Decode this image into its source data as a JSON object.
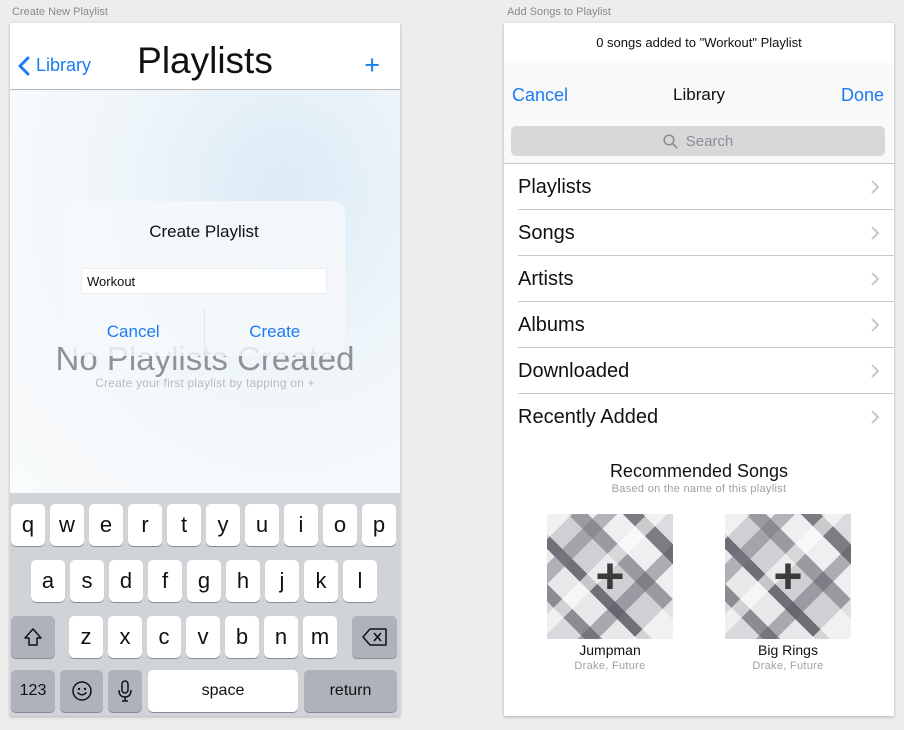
{
  "artboards": {
    "left_label": "Create New Playlist",
    "right_label": "Add Songs to Playlist"
  },
  "left_screen": {
    "nav": {
      "back_label": "Library",
      "title": "Playlists",
      "add_symbol": "+"
    },
    "empty_state": {
      "title": "No Playlists Created",
      "subtitle": "Create your first playlist by tapping on +"
    },
    "dialog": {
      "title": "Create Playlist",
      "input_value": "Workout",
      "cancel_label": "Cancel",
      "create_label": "Create"
    },
    "keyboard": {
      "row1": [
        "q",
        "w",
        "e",
        "r",
        "t",
        "y",
        "u",
        "i",
        "o",
        "p"
      ],
      "row2": [
        "a",
        "s",
        "d",
        "f",
        "g",
        "h",
        "j",
        "k",
        "l"
      ],
      "row3": [
        "z",
        "x",
        "c",
        "v",
        "b",
        "n",
        "m"
      ],
      "numbers_label": "123",
      "space_label": "space",
      "return_label": "return"
    }
  },
  "right_screen": {
    "banner": "0 songs added to \"Workout\" Playlist",
    "nav": {
      "cancel_label": "Cancel",
      "title": "Library",
      "done_label": "Done"
    },
    "search": {
      "placeholder": "Search"
    },
    "library_items": [
      "Playlists",
      "Songs",
      "Artists",
      "Albums",
      "Downloaded",
      "Recently Added"
    ],
    "recommended": {
      "title": "Recommended Songs",
      "subtitle": "Based on the name of this playlist",
      "songs": [
        {
          "title": "Jumpman",
          "artist": "Drake, Future"
        },
        {
          "title": "Big Rings",
          "artist": "Drake, Future"
        }
      ]
    }
  },
  "colors": {
    "accent": "#1a7cf0",
    "keyboard_bg": "#d0d4d9",
    "dark_key": "#aeb3bb"
  }
}
